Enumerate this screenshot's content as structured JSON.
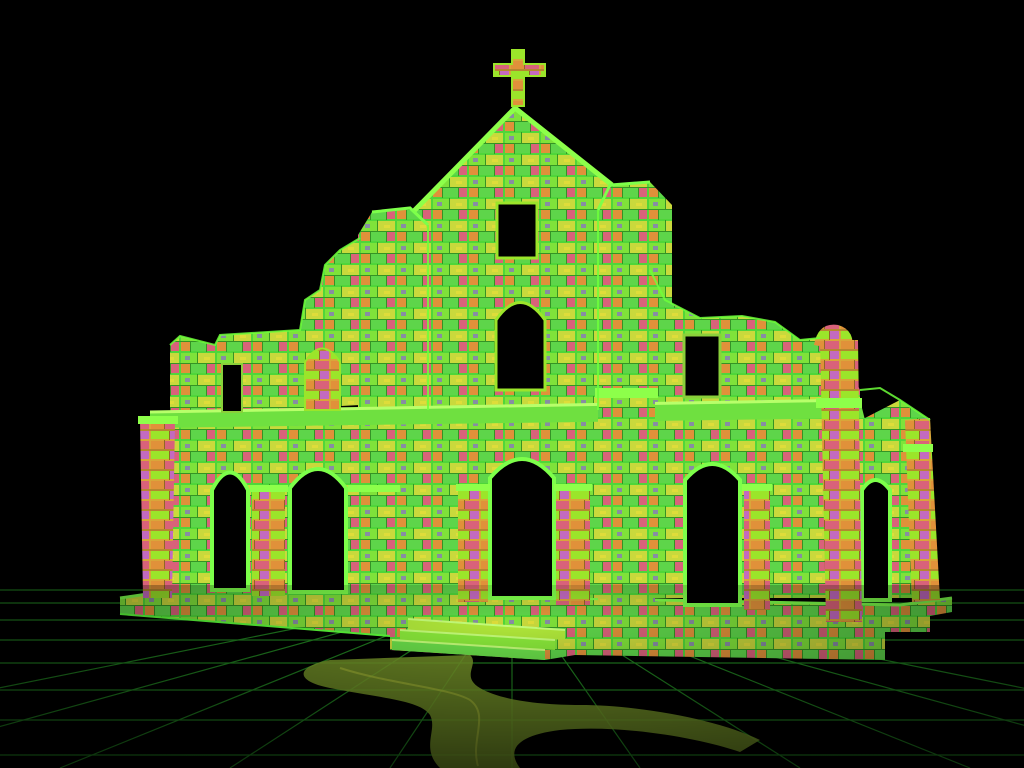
{
  "scene": {
    "colors": {
      "background": "#000000",
      "grid": "#1f7a1f",
      "grid_bright": "#3cc23c",
      "stone_green": "#4fd63a",
      "stone_lime": "#9be52a",
      "stone_yellow": "#e3df3a",
      "stone_orange": "#e0913a",
      "stone_pink": "#d9627a",
      "stone_violet": "#8a6ad0",
      "glow": "#5cff3a",
      "opening": "#000000"
    }
  }
}
